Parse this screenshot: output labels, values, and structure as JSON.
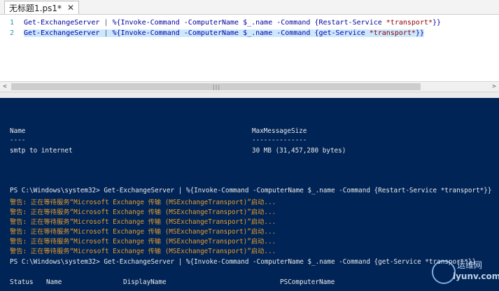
{
  "tab": {
    "title": "无标题1.ps1*",
    "close": "✕"
  },
  "editor": {
    "lines": [
      {
        "num": "1",
        "cmd": "Get-ExchangeServer",
        "pipe": " | ",
        "rest_a": "%{Invoke-Command -ComputerName $_.name -Command {Restart-Service ",
        "str": "*transport*",
        "rest_b": "}}"
      },
      {
        "num": "2",
        "cmd": "Get-ExchangeServer",
        "pipe": " | ",
        "rest_a": "%{Invoke-Command -ComputerName $_.name -Command {get-Service ",
        "str": "*transport*",
        "rest_b": "}}"
      }
    ]
  },
  "scrollbar": {
    "left_arrow": "<",
    "right_arrow": ">",
    "grip": "|||"
  },
  "console": {
    "header_name": "Name",
    "header_size": "MaxMessageSize",
    "underline_name": "----",
    "underline_size": "--------------",
    "row_name": "smtp to internet",
    "row_size": "30 MB (31,457,280 bytes)",
    "prompt1": "PS C:\\Windows\\system32> Get-ExchangeServer | %{Invoke-Command -ComputerName $_.name -Command {Restart-Service *transport*}}",
    "warnings": [
      "警告: 正在等待服务“Microsoft Exchange 传输 (MSExchangeTransport)”启动...",
      "警告: 正在等待服务“Microsoft Exchange 传输 (MSExchangeTransport)”启动...",
      "警告: 正在等待服务“Microsoft Exchange 传输 (MSExchangeTransport)”启动...",
      "警告: 正在等待服务“Microsoft Exchange 传输 (MSExchangeTransport)”启动...",
      "警告: 正在等待服务“Microsoft Exchange 传输 (MSExchangeTransport)”启动...",
      "警告: 正在等待服务“Microsoft Exchange 传输 (MSExchangeTransport)”启动..."
    ],
    "prompt2": "PS C:\\Windows\\system32> Get-ExchangeServer | %{Invoke-Command -ComputerName $_.name -Command {get-Service *transport*}}",
    "col_status": "Status",
    "col_name": "Name",
    "col_display": "DisplayName",
    "col_pscomputer": "PSComputerName"
  },
  "watermark": {
    "text_top": "运维网",
    "text_bottom": "iyunv.com"
  }
}
